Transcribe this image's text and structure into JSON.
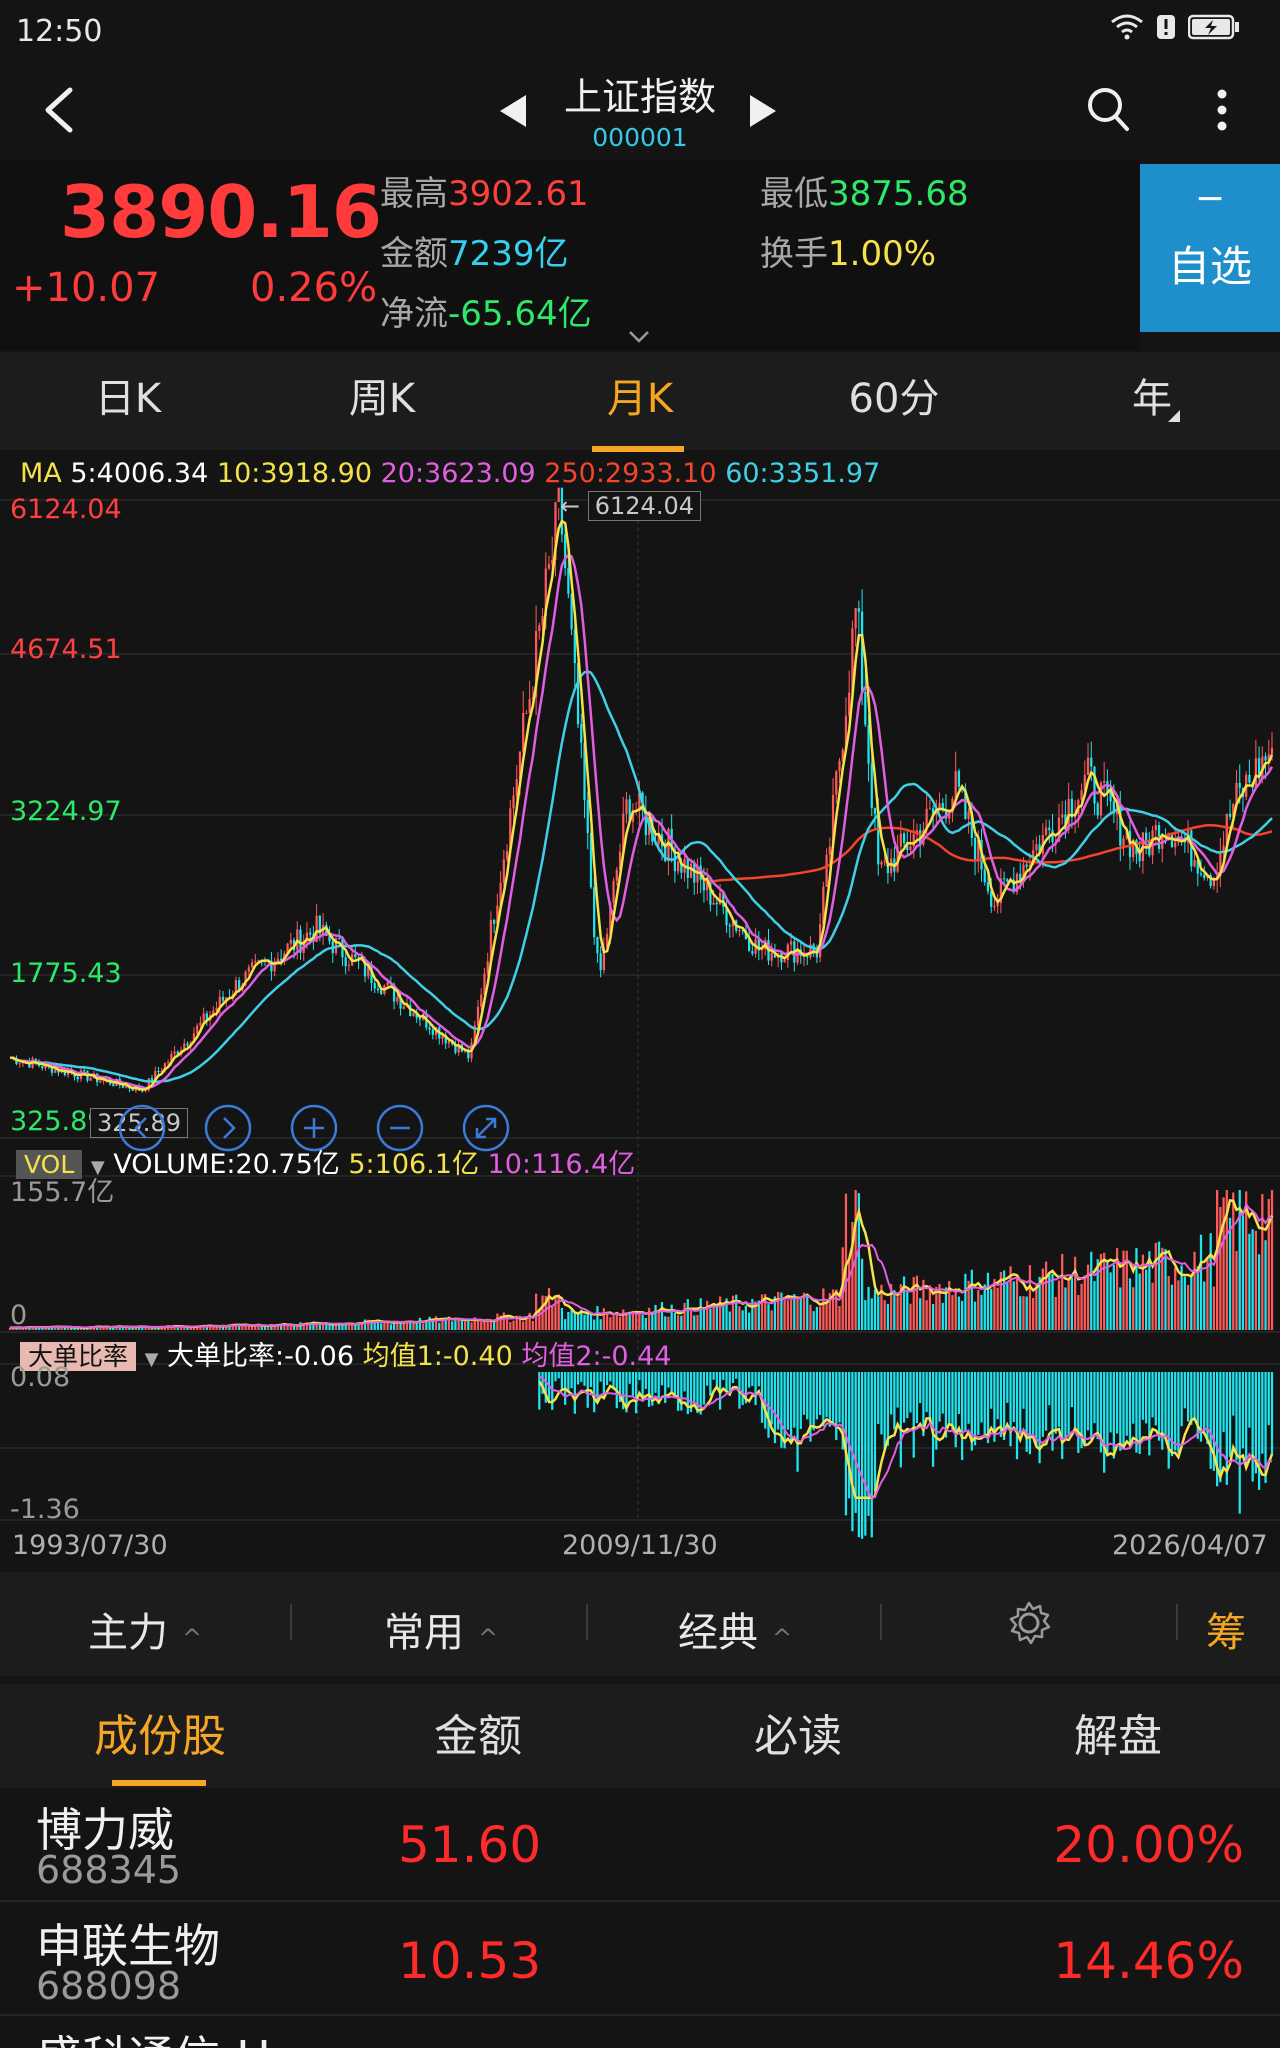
{
  "status": {
    "time": "12:50"
  },
  "header": {
    "title": "上证指数",
    "code": "000001"
  },
  "quote": {
    "price": "3890.16",
    "change": "+10.07",
    "change_pct": "0.26%",
    "high_label": "最高",
    "high": "3902.61",
    "low_label": "最低",
    "low": "3875.68",
    "amount_label": "金额",
    "amount": "7239亿",
    "turnover_label": "换手",
    "turnover": "1.00%",
    "netflow_label": "净流",
    "netflow": "-65.64亿",
    "fav_minus": "−",
    "fav_label": "自选"
  },
  "period_tabs": [
    {
      "label": "日K"
    },
    {
      "label": "周K"
    },
    {
      "label": "月K",
      "active": true
    },
    {
      "label": "60分"
    },
    {
      "label": "年"
    }
  ],
  "ma": {
    "prefix": "MA",
    "ma5": "5:4006.34",
    "ma10": "10:3918.90",
    "ma20": "20:3623.09",
    "ma250": "250:2933.10",
    "ma60": "60:3351.97"
  },
  "colors": {
    "up": "#ff5a5a",
    "down": "#1ee6f0",
    "ma5": "#ffffff",
    "ma10": "#f5e14a",
    "ma20": "#e05fe0",
    "ma250": "#f2452a",
    "ma60": "#3fd0e8",
    "accent": "#f5a623"
  },
  "chart_data": {
    "type": "line",
    "price_axis": {
      "labels": [
        "6124.04",
        "4674.51",
        "3224.97",
        "1775.43",
        "325.89"
      ],
      "ylim": [
        325.89,
        6124.04
      ]
    },
    "max_marker": "6124.04",
    "min_marker": "325.89",
    "x_labels": [
      "1993/07/30",
      "2009/11/30",
      "2026/04/07"
    ],
    "close_anchors": [
      {
        "date": "1993/07/30",
        "value": 1000
      },
      {
        "date": "1996/12/31",
        "value": 700
      },
      {
        "date": "1999/06/30",
        "value": 1700
      },
      {
        "date": "2001/06/30",
        "value": 2200
      },
      {
        "date": "2005/06/30",
        "value": 1000
      },
      {
        "date": "2007/10/31",
        "value": 6124.04
      },
      {
        "date": "2008/10/31",
        "value": 1700
      },
      {
        "date": "2009/07/31",
        "value": 3400
      },
      {
        "date": "2012/12/31",
        "value": 2000
      },
      {
        "date": "2014/06/30",
        "value": 2000
      },
      {
        "date": "2015/06/30",
        "value": 5180
      },
      {
        "date": "2016/01/31",
        "value": 2700
      },
      {
        "date": "2018/01/31",
        "value": 3500
      },
      {
        "date": "2019/01/31",
        "value": 2450
      },
      {
        "date": "2021/06/30",
        "value": 3600
      },
      {
        "date": "2022/10/31",
        "value": 2900
      },
      {
        "date": "2023/06/30",
        "value": 3200
      },
      {
        "date": "2024/09/30",
        "value": 2700
      },
      {
        "date": "2025/03/31",
        "value": 3350
      },
      {
        "date": "2026/04/07",
        "value": 3890.16
      }
    ],
    "volume": {
      "label": "VOLUME:20.75亿",
      "ma5": "5:106.1亿",
      "ma10": "10:116.4亿",
      "axis_max": "155.7亿",
      "axis_min": "0"
    },
    "big_order": {
      "label": "大单比率:-0.06",
      "avg1": "均值1:-0.40",
      "avg2": "均值2:-0.44",
      "axis_max": "0.08",
      "axis_min": "-1.36"
    }
  },
  "indicator_tags": {
    "vol": "VOL",
    "big_order": "大单比率"
  },
  "toolbar": {
    "items": [
      "主力",
      "常用",
      "经典"
    ],
    "chip": "筹"
  },
  "stock_tabs": [
    {
      "label": "成份股",
      "active": true
    },
    {
      "label": "金额"
    },
    {
      "label": "必读"
    },
    {
      "label": "解盘"
    }
  ],
  "stocks": [
    {
      "name": "博力威",
      "code": "688345",
      "price": "51.60",
      "pct": "20.00%"
    },
    {
      "name": "申联生物",
      "code": "688098",
      "price": "10.53",
      "pct": "14.46%"
    },
    {
      "name": "盛科通信-U",
      "code": "",
      "price": "",
      "pct": ""
    }
  ]
}
